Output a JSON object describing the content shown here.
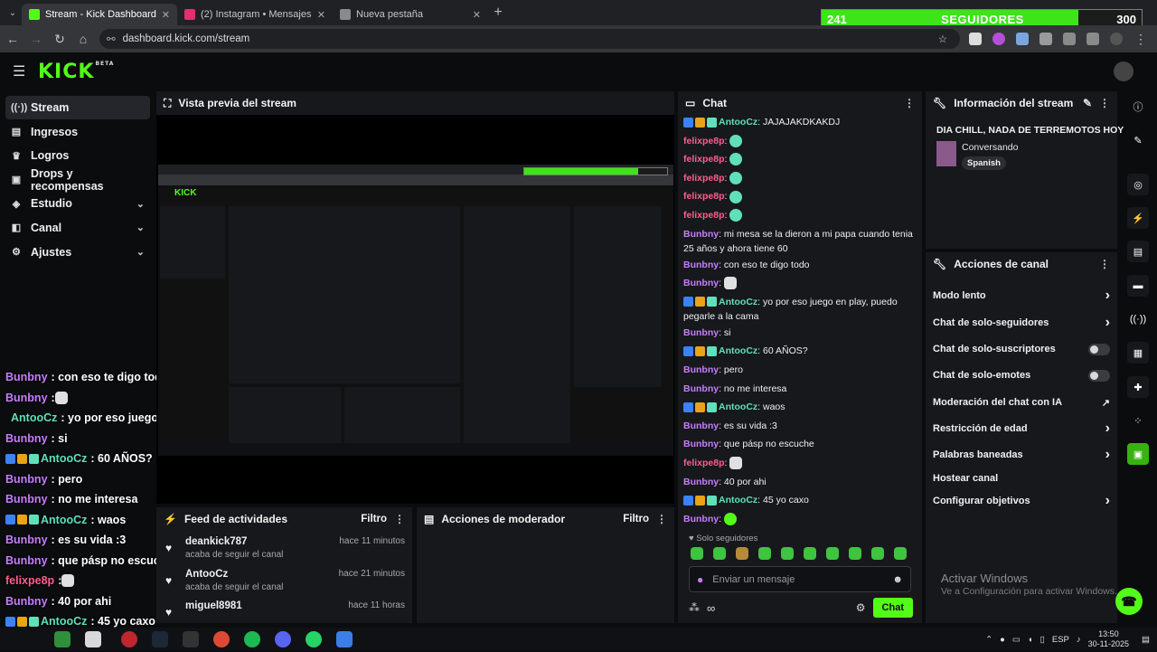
{
  "browser": {
    "tabs": [
      {
        "title": "Stream - Kick Dashboard",
        "active": true,
        "color": "#53fc18"
      },
      {
        "title": "(2) Instagram • Mensajes",
        "active": false,
        "color": "#e1306c"
      },
      {
        "title": "Nueva pestaña",
        "active": false,
        "color": "#8a8a8a"
      }
    ],
    "url": "dashboard.kick.com/stream"
  },
  "follow_goal": {
    "current": "241",
    "label": "SEGUIDORES",
    "goal": "300",
    "progress": 0.8033
  },
  "app": {
    "logo": "KICK",
    "beta": "BETA"
  },
  "sidebar": {
    "items": [
      {
        "label": "Stream",
        "icon": "stream-icon",
        "glyph": "((·))",
        "active": true
      },
      {
        "label": "Ingresos",
        "icon": "income-icon",
        "glyph": "▤"
      },
      {
        "label": "Logros",
        "icon": "trophy-icon",
        "glyph": "♛"
      },
      {
        "label": "Drops y recompensas",
        "icon": "gift-icon",
        "glyph": "▣"
      },
      {
        "label": "Estudio",
        "icon": "studio-icon",
        "glyph": "◈",
        "expand": true
      },
      {
        "label": "Canal",
        "icon": "channel-icon",
        "glyph": "◧",
        "expand": true
      },
      {
        "label": "Ajustes",
        "icon": "settings-icon",
        "glyph": "⚙",
        "expand": true
      }
    ]
  },
  "overlay_chat": [
    {
      "user": "Bunbny",
      "color": "#c77dff",
      "text": ": con eso te digo todo",
      "badges": false
    },
    {
      "user": "Bunbny",
      "color": "#c77dff",
      "text": ": ",
      "emote": true,
      "badges": false
    },
    {
      "user": "AntooCz",
      "color": "#60e0ba",
      "text": ": yo por eso juego en play, puedo pegarle a la cama",
      "badges": true
    },
    {
      "user": "Bunbny",
      "color": "#c77dff",
      "text": ": si",
      "badges": false
    },
    {
      "user": "AntooCz",
      "color": "#60e0ba",
      "text": ": 60 AÑOS?",
      "badges": true
    },
    {
      "user": "Bunbny",
      "color": "#c77dff",
      "text": ": pero",
      "badges": false
    },
    {
      "user": "Bunbny",
      "color": "#c77dff",
      "text": ": no me interesa",
      "badges": false
    },
    {
      "user": "AntooCz",
      "color": "#60e0ba",
      "text": ": waos",
      "badges": true
    },
    {
      "user": "Bunbny",
      "color": "#c77dff",
      "text": ": es su vida :3",
      "badges": false
    },
    {
      "user": "Bunbny",
      "color": "#c77dff",
      "text": ": que pásp no escuche",
      "badges": false
    },
    {
      "user": "felixpe8p",
      "color": "#ff5d8f",
      "text": ": ",
      "emote": true,
      "badges": false
    },
    {
      "user": "Bunbny",
      "color": "#c77dff",
      "text": ": 40 por ahi",
      "badges": false
    },
    {
      "user": "AntooCz",
      "color": "#60e0ba",
      "text": ": 45 yo caxo",
      "badges": true
    },
    {
      "user": "Bunbny",
      "color": "#c77dff",
      "text": "",
      "badges": false
    }
  ],
  "preview": {
    "title": "Vista previa del stream"
  },
  "feed": {
    "title": "Feed de actividades",
    "filter": "Filtro",
    "items": [
      {
        "name": "deankick787",
        "sub": "acaba de seguir el canal",
        "time": "hace 11 minutos"
      },
      {
        "name": "AntooCz",
        "sub": "acaba de seguir el canal",
        "time": "hace 21 minutos"
      },
      {
        "name": "miguel8981",
        "sub": "",
        "time": "hace 11 horas"
      }
    ]
  },
  "mod_actions": {
    "title": "Acciones de moderador",
    "filter": "Filtro"
  },
  "chat": {
    "title": "Chat",
    "messages": [
      {
        "user": "AntooCz",
        "color": "#60e0ba",
        "text": "JAJAJAKDKAKDJ",
        "badges": true
      },
      {
        "user": "felixpe8p",
        "color": "#ff5d8f",
        "text": "",
        "emote": "teal"
      },
      {
        "user": "felixpe8p",
        "color": "#ff5d8f",
        "text": "",
        "emote": "teal"
      },
      {
        "user": "felixpe8p",
        "color": "#ff5d8f",
        "text": "",
        "emote": "teal"
      },
      {
        "user": "felixpe8p",
        "color": "#ff5d8f",
        "text": "",
        "emote": "teal"
      },
      {
        "user": "felixpe8p",
        "color": "#ff5d8f",
        "text": "",
        "emote": "teal"
      },
      {
        "user": "Bunbny",
        "color": "#c77dff",
        "text": "mi mesa se la dieron a mi papa cuando tenia 25 años y ahora tiene 60"
      },
      {
        "user": "Bunbny",
        "color": "#c77dff",
        "text": "con eso te digo todo"
      },
      {
        "user": "Bunbny",
        "color": "#c77dff",
        "text": "",
        "emote": "white"
      },
      {
        "user": "AntooCz",
        "color": "#60e0ba",
        "text": "yo por eso juego en play, puedo pegarle a la cama",
        "badges": true
      },
      {
        "user": "Bunbny",
        "color": "#c77dff",
        "text": "si"
      },
      {
        "user": "AntooCz",
        "color": "#60e0ba",
        "text": "60 AÑOS?",
        "badges": true
      },
      {
        "user": "Bunbny",
        "color": "#c77dff",
        "text": "pero"
      },
      {
        "user": "Bunbny",
        "color": "#c77dff",
        "text": "no me interesa"
      },
      {
        "user": "AntooCz",
        "color": "#60e0ba",
        "text": "waos",
        "badges": true
      },
      {
        "user": "Bunbny",
        "color": "#c77dff",
        "text": "es su vida :3"
      },
      {
        "user": "Bunbny",
        "color": "#c77dff",
        "text": "que pásp no escuche"
      },
      {
        "user": "felixpe8p",
        "color": "#ff5d8f",
        "text": "",
        "emote": "white"
      },
      {
        "user": "Bunbny",
        "color": "#c77dff",
        "text": "40 por ahi"
      },
      {
        "user": "AntooCz",
        "color": "#60e0ba",
        "text": "45 yo caxo",
        "badges": true
      },
      {
        "user": "Bunbny",
        "color": "#c77dff",
        "text": "",
        "emote": "green"
      }
    ],
    "followers_only_label": "Solo seguidores",
    "input_placeholder": "Enviar un mensaje",
    "send_label": "Chat"
  },
  "stream_info": {
    "title": "Información del stream",
    "stream_title": "DIA CHILL, NADA DE TERREMOTOS HOY",
    "category": "Conversando",
    "language": "Spanish"
  },
  "channel_actions": {
    "title": "Acciones de canal",
    "items": [
      {
        "label": "Modo lento",
        "kind": "chevron"
      },
      {
        "label": "Chat de solo-seguidores",
        "kind": "chevron"
      },
      {
        "label": "Chat de solo-suscriptores",
        "kind": "toggle"
      },
      {
        "label": "Chat de solo-emotes",
        "kind": "toggle"
      },
      {
        "label": "Moderación del chat con IA",
        "kind": "external"
      },
      {
        "label": "Restricción de edad",
        "kind": "chevron"
      },
      {
        "label": "Palabras baneadas",
        "kind": "chevron"
      },
      {
        "label": "Hostear canal",
        "kind": "none"
      },
      {
        "label": "Configurar objetivos",
        "kind": "chevron"
      }
    ]
  },
  "windows": {
    "activate_title": "Activar Windows",
    "activate_sub": "Ve a Configuración para activar Windows.",
    "lang": "ESP",
    "time": "13:50",
    "date": "30-11-2025"
  }
}
